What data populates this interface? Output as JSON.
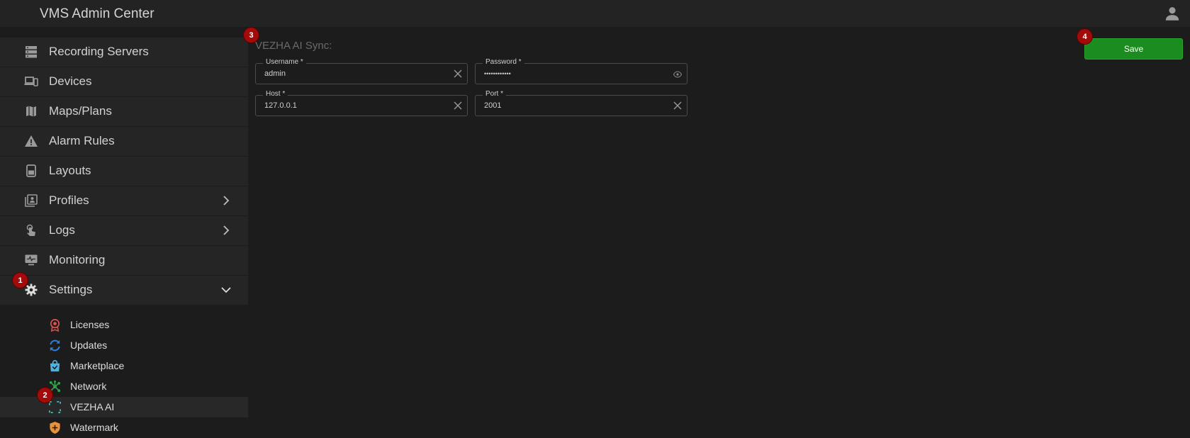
{
  "header": {
    "title": "VMS Admin Center",
    "user_icon": "user-icon"
  },
  "sidebar": {
    "items": [
      {
        "label": "Recording Servers",
        "icon": "server-icon"
      },
      {
        "label": "Devices",
        "icon": "devices-icon"
      },
      {
        "label": "Maps/Plans",
        "icon": "map-icon"
      },
      {
        "label": "Alarm Rules",
        "icon": "warning-icon"
      },
      {
        "label": "Layouts",
        "icon": "layout-icon"
      },
      {
        "label": "Profiles",
        "icon": "profiles-icon",
        "expandable": true
      },
      {
        "label": "Logs",
        "icon": "touch-icon",
        "expandable": true
      },
      {
        "label": "Monitoring",
        "icon": "monitor-icon"
      },
      {
        "label": "Settings",
        "icon": "gear-icon",
        "expanded": true
      }
    ],
    "submenu": [
      {
        "label": "Licenses",
        "icon": "award-icon",
        "color": "#d9534f"
      },
      {
        "label": "Updates",
        "icon": "refresh-icon",
        "color": "#2f7fd8"
      },
      {
        "label": "Marketplace",
        "icon": "shopping-bag-icon",
        "color": "#4fb3e0"
      },
      {
        "label": "Network",
        "icon": "network-icon",
        "color": "#27a845"
      },
      {
        "label": "VEZHA AI",
        "icon": "focus-icon",
        "color": "#3fc7b8",
        "active": true
      },
      {
        "label": "Watermark",
        "icon": "shield-icon",
        "color": "#e8923a"
      }
    ]
  },
  "main": {
    "section_title": "VEZHA AI Sync:",
    "fields": {
      "username": {
        "label": "Username *",
        "value": "admin"
      },
      "password": {
        "label": "Password *",
        "value": "••••••••••••"
      },
      "host": {
        "label": "Host *",
        "value": "127.0.0.1"
      },
      "port": {
        "label": "Port *",
        "value": "2001"
      }
    },
    "save_label": "Save"
  },
  "badges": {
    "b1": "1",
    "b2": "2",
    "b3": "3",
    "b4": "4"
  },
  "colors": {
    "save_button": "#1b8c1f",
    "badge": "#a30a0a",
    "active_row": "#282828"
  }
}
